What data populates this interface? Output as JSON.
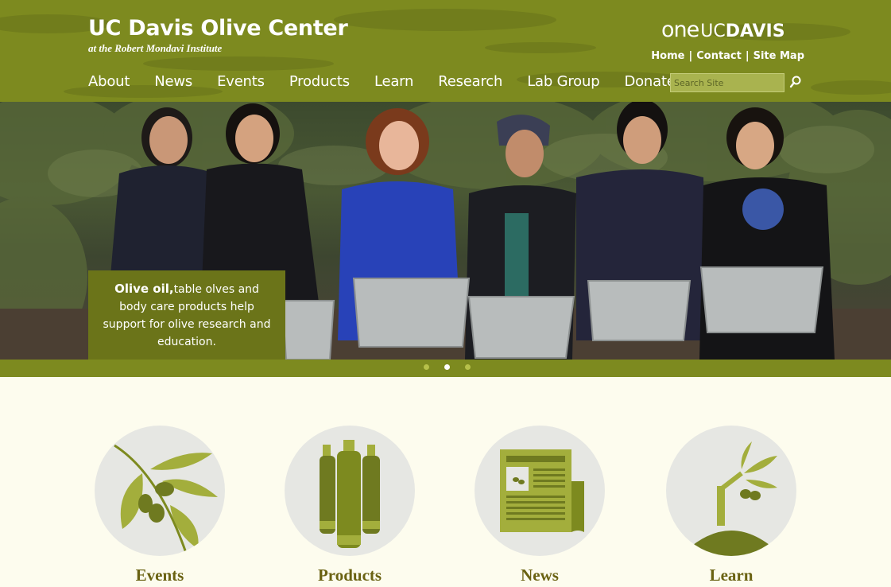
{
  "header": {
    "site_title": "UC Davis Olive Center",
    "site_subtitle": "at the Robert Mondavi Institute",
    "brand_one": "one",
    "brand_uc": "UC",
    "brand_davis": "DAVIS",
    "util_links": [
      {
        "label": "Home"
      },
      {
        "label": "Contact"
      },
      {
        "label": "Site Map"
      }
    ],
    "util_separator": "|",
    "nav": [
      {
        "label": "About"
      },
      {
        "label": "News"
      },
      {
        "label": "Events"
      },
      {
        "label": "Products"
      },
      {
        "label": "Learn"
      },
      {
        "label": "Research"
      },
      {
        "label": "Lab Group"
      },
      {
        "label": "Donate"
      }
    ],
    "search": {
      "placeholder": "Search Site",
      "value": "",
      "icon": "search-icon"
    }
  },
  "hero": {
    "caption_bold": "Olive oil,",
    "caption_text": "table olves and body care products help support for olive research and education.",
    "slides": 3,
    "active_slide": 2
  },
  "features": [
    {
      "label": "Events",
      "icon": "olive-branch-icon"
    },
    {
      "label": "Products",
      "icon": "olive-oil-bottles-icon"
    },
    {
      "label": "News",
      "icon": "newspaper-icon"
    },
    {
      "label": "Learn",
      "icon": "olive-sapling-icon"
    }
  ],
  "colors": {
    "header_green": "#7d8a1f",
    "caption_green": "#6b7419",
    "page_bg": "#fdfcee",
    "label_brown": "#6a6212",
    "icon_light": "#a3ae3c",
    "icon_dark": "#6f7a20"
  }
}
